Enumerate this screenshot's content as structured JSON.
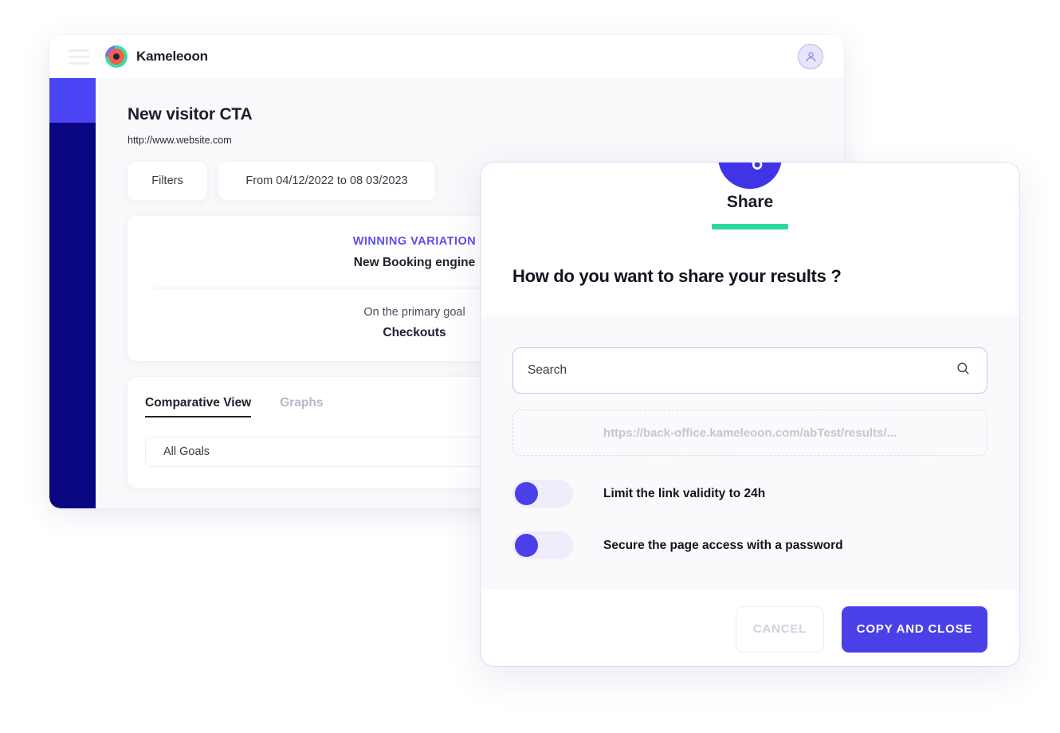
{
  "app": {
    "brand": "Kameleoon",
    "menu_icon": "hamburger-icon",
    "avatar_icon": "user-avatar-icon",
    "page_title": "New visitor CTA",
    "page_url": "http://www.website.com",
    "filters_label": "Filters",
    "date_range_label": "From 04/12/2022 to 08 03/2023",
    "winning_card": {
      "label": "WINNING VARIATION",
      "variation": "New Booking engine",
      "goal_prefix": "On the primary goal",
      "goal": "Checkouts"
    },
    "tabs": [
      {
        "label": "Comparative View",
        "active": true
      },
      {
        "label": "Graphs",
        "active": false
      }
    ],
    "goal_select_value": "All Goals"
  },
  "modal": {
    "icon": "share-icon",
    "title": "Share",
    "question": "How do you want to share your results ?",
    "search": {
      "placeholder": "Search",
      "value": "",
      "icon": "search-icon"
    },
    "share_url": "https://back-office.kameleoon.com/abTest/results/...",
    "toggles": [
      {
        "label": "Limit the link validity to 24h",
        "on": false
      },
      {
        "label": "Secure the page access with a password",
        "on": false
      }
    ],
    "cancel_label": "CANCEL",
    "confirm_label": "COPY AND CLOSE"
  },
  "colors": {
    "accent_purple": "#4b40e8",
    "winning_purple": "#5b4ff0",
    "teal_underline": "#2ad8a0",
    "sidebar_navy": "#0a0580",
    "sidebar_active": "#4b44f5"
  }
}
